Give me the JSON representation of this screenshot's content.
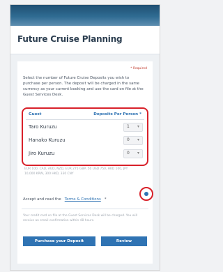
{
  "header": {
    "title": "Future Cruise Planning"
  },
  "form": {
    "required_note": "* Required",
    "instruction": "Select the number of Future Cruise Deposits you wish to purchase per person. The deposit will be charged in the same currency as your current booking and use the card on file at the Guest Services Desk.",
    "table": {
      "header_guest": "Guest",
      "header_deposits": "Deposits Per Person *",
      "rows": [
        {
          "name": "Taro Kuruzu",
          "qty": "1"
        },
        {
          "name": "Hanako Kuruzu",
          "qty": "0"
        },
        {
          "name": "Jiro Kuruzu",
          "qty": "0"
        }
      ]
    },
    "fine_print": "EUR 100, CAD, AUD, NZD, EUR 275 GBP, 50 USD 750, HKD 100, JPY 10,000 KRW, 300 HKD, 330 CNY",
    "accept": {
      "prefix": "Accept and read the",
      "link": "Terms & Conditions",
      "suffix": " *"
    },
    "note": "Your credit card on file at the Guest Services Desk will be charged. You will receive an email confirmation within 48 hours.",
    "buttons": {
      "purchase": "Purchase your Deposit",
      "review": "Review"
    }
  },
  "icons": {
    "stepper_caret": "chevron-down-icon"
  },
  "colors": {
    "accent": "#2f73b3",
    "highlight": "#d8212a"
  }
}
